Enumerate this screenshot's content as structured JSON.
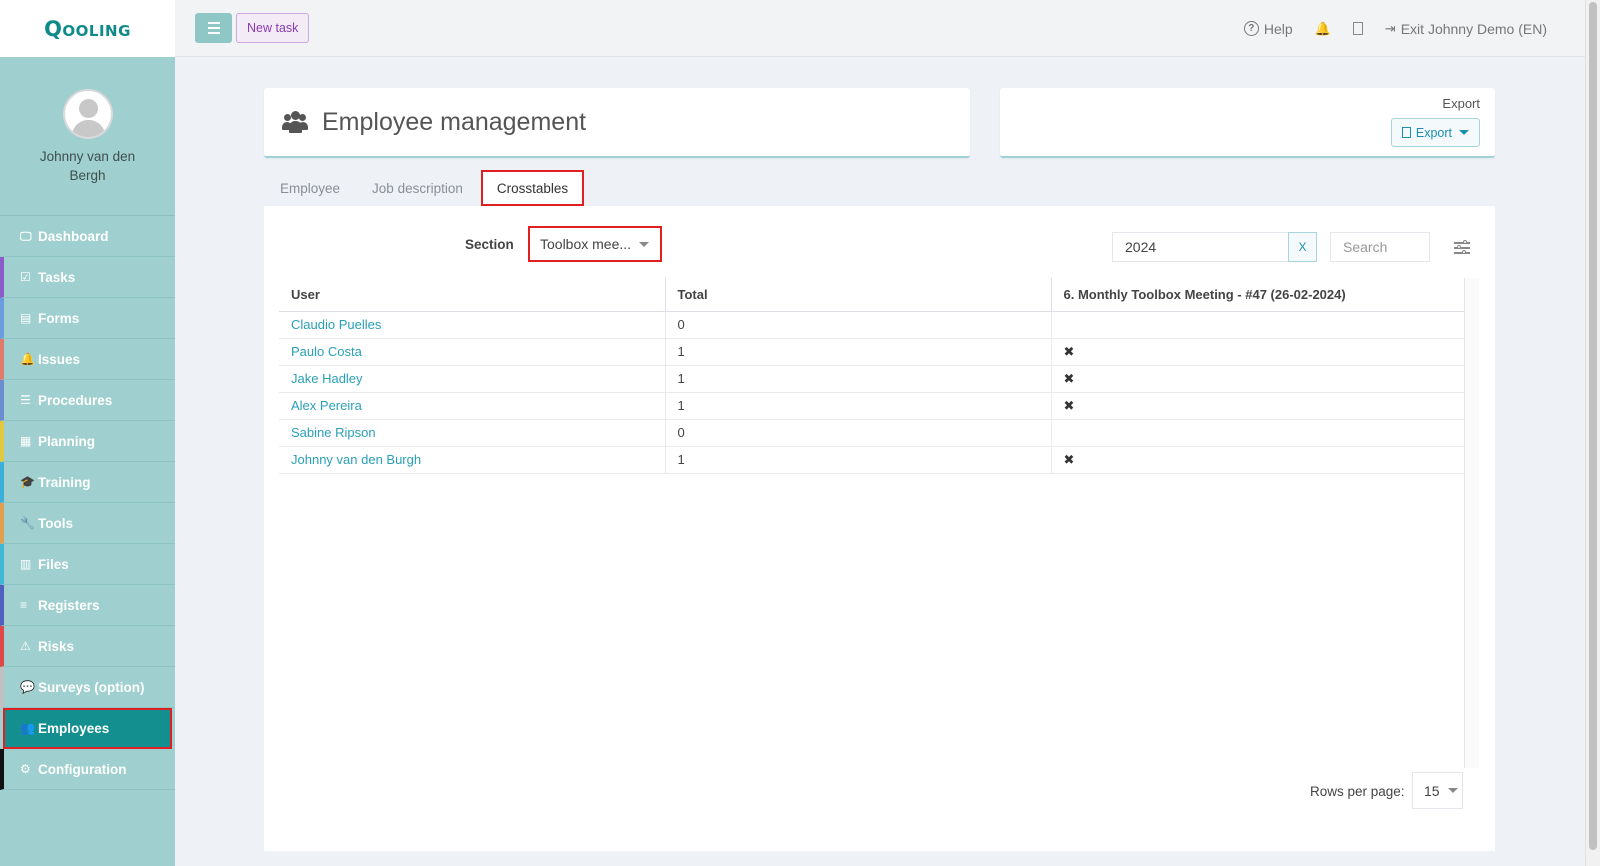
{
  "app": {
    "logo": "Qooling"
  },
  "user": {
    "name": "Johnny van den Bergh"
  },
  "sidebar": {
    "items": [
      {
        "label": "Dashboard",
        "icon": "monitor-icon",
        "glyph": "🖵",
        "color": "#9fcfcf"
      },
      {
        "label": "Tasks",
        "icon": "check-square-icon",
        "glyph": "☑",
        "color": "#8b5cc6"
      },
      {
        "label": "Forms",
        "icon": "file-icon",
        "glyph": "▤",
        "color": "#6c9ce0"
      },
      {
        "label": "Issues",
        "icon": "bell-icon",
        "glyph": "🔔",
        "color": "#e07a6a"
      },
      {
        "label": "Procedures",
        "icon": "list-icon",
        "glyph": "☰",
        "color": "#6c8cd0"
      },
      {
        "label": "Planning",
        "icon": "calendar-icon",
        "glyph": "▦",
        "color": "#e0c840"
      },
      {
        "label": "Training",
        "icon": "graduation-cap-icon",
        "glyph": "🎓",
        "color": "#3bb0d8"
      },
      {
        "label": "Tools",
        "icon": "wrench-icon",
        "glyph": "🔧",
        "color": "#e0a050"
      },
      {
        "label": "Files",
        "icon": "file-pdf-icon",
        "glyph": "▥",
        "color": "#40b8d8"
      },
      {
        "label": "Registers",
        "icon": "bars-icon",
        "glyph": "≡",
        "color": "#5060c0"
      },
      {
        "label": "Risks",
        "icon": "warning-icon",
        "glyph": "⚠",
        "color": "#e04848"
      },
      {
        "label": "Surveys (option)",
        "icon": "comment-icon",
        "glyph": "💬",
        "color": "#c0c0c0"
      },
      {
        "label": "Employees",
        "icon": "users-icon",
        "glyph": "👥",
        "color": "#138f8f"
      },
      {
        "label": "Configuration",
        "icon": "gear-icon",
        "glyph": "⚙",
        "color": "#111111"
      }
    ],
    "active": "Employees"
  },
  "topbar": {
    "new_task": "New task",
    "help": "Help",
    "exit": "Exit Johnny Demo (EN)"
  },
  "page": {
    "title": "Employee management",
    "export_label": "Export",
    "export_button": "Export"
  },
  "tabs": [
    {
      "label": "Employee"
    },
    {
      "label": "Job description"
    },
    {
      "label": "Crosstables"
    }
  ],
  "filters": {
    "section_label": "Section",
    "section_value": "Toolbox mee...",
    "year": "2024",
    "clear": "X",
    "search_placeholder": "Search"
  },
  "table": {
    "headers": [
      "User",
      "Total",
      "6. Monthly Toolbox Meeting - #47 (26-02-2024)"
    ],
    "rows": [
      {
        "user": "Claudio Puelles",
        "total": "0",
        "mark": ""
      },
      {
        "user": "Paulo Costa",
        "total": "1",
        "mark": "✖"
      },
      {
        "user": "Jake Hadley",
        "total": "1",
        "mark": "✖"
      },
      {
        "user": "Alex Pereira",
        "total": "1",
        "mark": "✖"
      },
      {
        "user": "Sabine Ripson",
        "total": "0",
        "mark": ""
      },
      {
        "user": "Johnny van den Burgh",
        "total": "1",
        "mark": "✖"
      }
    ]
  },
  "pagination": {
    "rows_per_page_label": "Rows per page:",
    "rows_per_page": "15"
  },
  "colors": {
    "accent": "#138f8f",
    "sidebar": "#9fcfcf",
    "link": "#2aa0b8",
    "highlight": "#e02020"
  }
}
